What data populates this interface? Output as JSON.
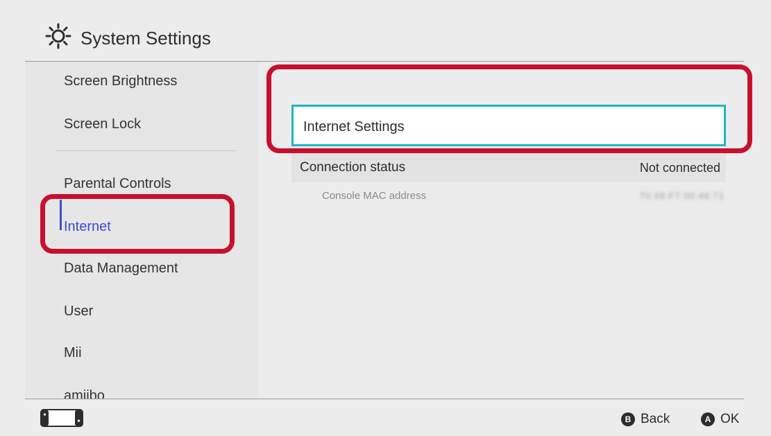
{
  "header": {
    "title": "System Settings",
    "icon": "gear-icon"
  },
  "sidebar": {
    "items": [
      {
        "label": "Screen Brightness"
      },
      {
        "label": "Screen Lock"
      },
      {
        "label": "Parental Controls"
      },
      {
        "label": "Internet"
      },
      {
        "label": "Data Management"
      },
      {
        "label": "User"
      },
      {
        "label": "Mii"
      },
      {
        "label": "amiibo"
      }
    ],
    "selected": "Internet"
  },
  "main": {
    "internet_settings_label": "Internet Settings",
    "connection_status_label": "Connection status",
    "connection_status_value": "Not connected",
    "mac_label": "Console MAC address",
    "mac_value": "70:48:F7:00:46:71"
  },
  "footer": {
    "back_label": "Back",
    "back_button": "B",
    "ok_label": "OK",
    "ok_button": "A",
    "console_icon": "handheld-console-icon"
  },
  "colors": {
    "accent_selected": "#3b4dd6",
    "focus_border": "#1fb7c2",
    "highlight_annotation": "#c8102e",
    "background": "#ececec"
  }
}
